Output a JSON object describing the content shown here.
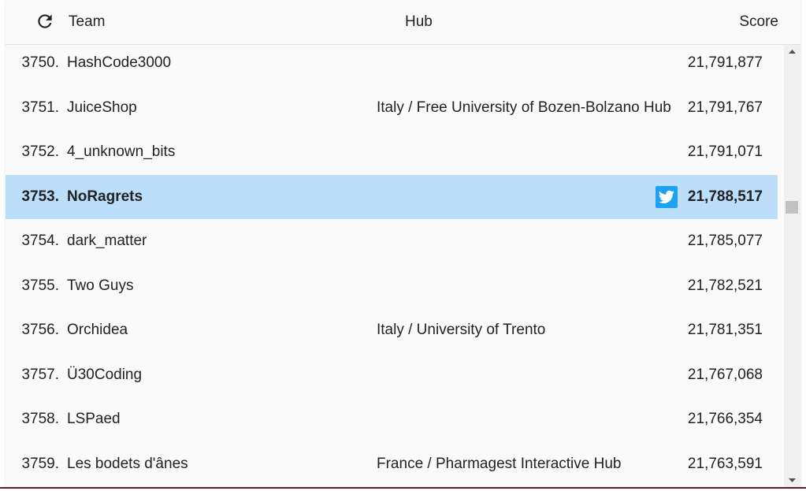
{
  "header": {
    "team_label": "Team",
    "hub_label": "Hub",
    "score_label": "Score",
    "refresh_icon": "refresh-icon"
  },
  "colors": {
    "highlight_row": "#bbdefb",
    "twitter": "#1da1f2",
    "bottom_border": "#5a1f2a"
  },
  "rows": [
    {
      "rank": "3750.",
      "team": "HashCode3000",
      "hub": "",
      "score": "21,791,877",
      "highlight": false
    },
    {
      "rank": "3751.",
      "team": "JuiceShop",
      "hub": "Italy / Free University of Bozen-Bolzano Hub",
      "score": "21,791,767",
      "highlight": false
    },
    {
      "rank": "3752.",
      "team": "4_unknown_bits",
      "hub": "",
      "score": "21,791,071",
      "highlight": false
    },
    {
      "rank": "3753.",
      "team": "NoRagrets",
      "hub": "",
      "score": "21,788,517",
      "highlight": true,
      "share_icon": "twitter-icon"
    },
    {
      "rank": "3754.",
      "team": "dark_matter",
      "hub": "",
      "score": "21,785,077",
      "highlight": false
    },
    {
      "rank": "3755.",
      "team": "Two Guys",
      "hub": "",
      "score": "21,782,521",
      "highlight": false
    },
    {
      "rank": "3756.",
      "team": "Orchidea",
      "hub": "Italy / University of Trento",
      "score": "21,781,351",
      "highlight": false
    },
    {
      "rank": "3757.",
      "team": "Ü30Coding",
      "hub": "",
      "score": "21,767,068",
      "highlight": false
    },
    {
      "rank": "3758.",
      "team": "LSPaed",
      "hub": "",
      "score": "21,766,354",
      "highlight": false
    },
    {
      "rank": "3759.",
      "team": "Les bodets d'ânes",
      "hub": "France / Pharmagest Interactive Hub",
      "score": "21,763,591",
      "highlight": false
    }
  ]
}
